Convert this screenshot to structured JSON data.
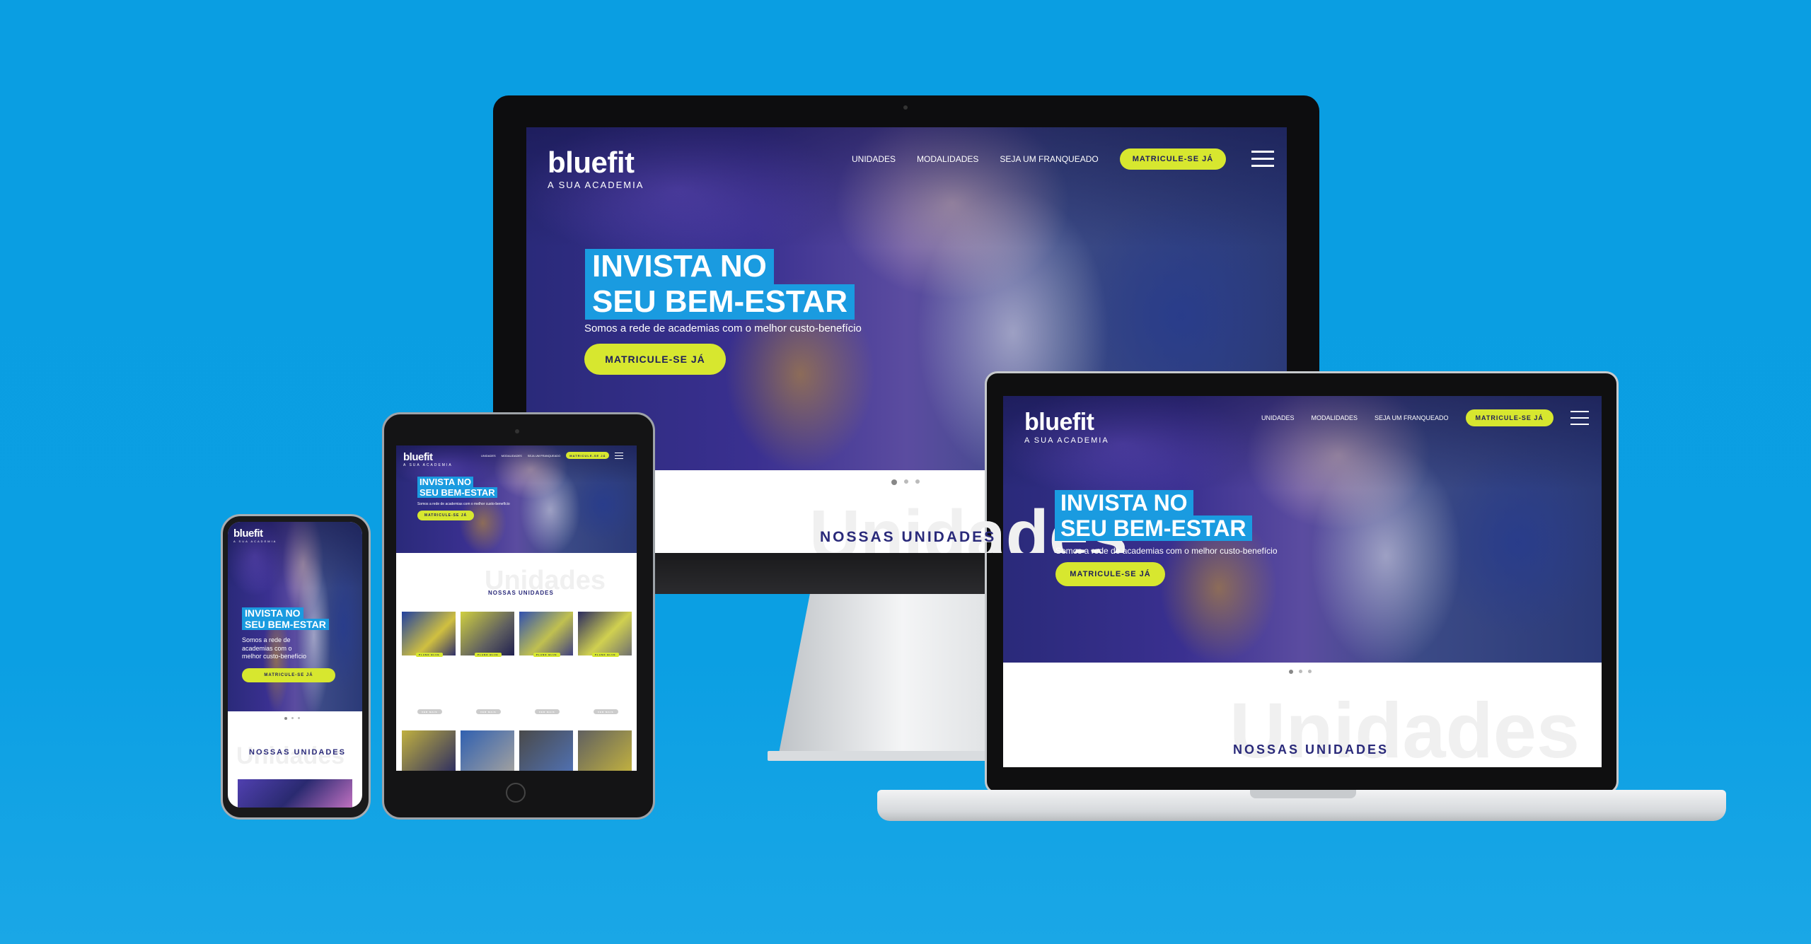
{
  "brand": {
    "name": "bluefit",
    "tagline": "A SUA ACADEMIA"
  },
  "nav": {
    "items": [
      "UNIDADES",
      "MODALIDADES",
      "SEJA UM FRANQUEADO"
    ],
    "cta": "MATRICULE-SE JÁ"
  },
  "hero": {
    "line1": "INVISTA NO",
    "line2": "SEU BEM-ESTAR",
    "subtitle": "Somos a rede de academias com o melhor custo-benefício",
    "button": "MATRICULE-SE JÁ"
  },
  "units": {
    "title": "NOSSAS UNIDADES",
    "ghost": "Unidades",
    "more": "VER MAIS",
    "badge": "PLANO BLUE"
  },
  "colors": {
    "background": "#0b9fe3",
    "accent": "#d7e72f",
    "highlight": "#1a9be0",
    "navy": "#2a2a7a"
  }
}
